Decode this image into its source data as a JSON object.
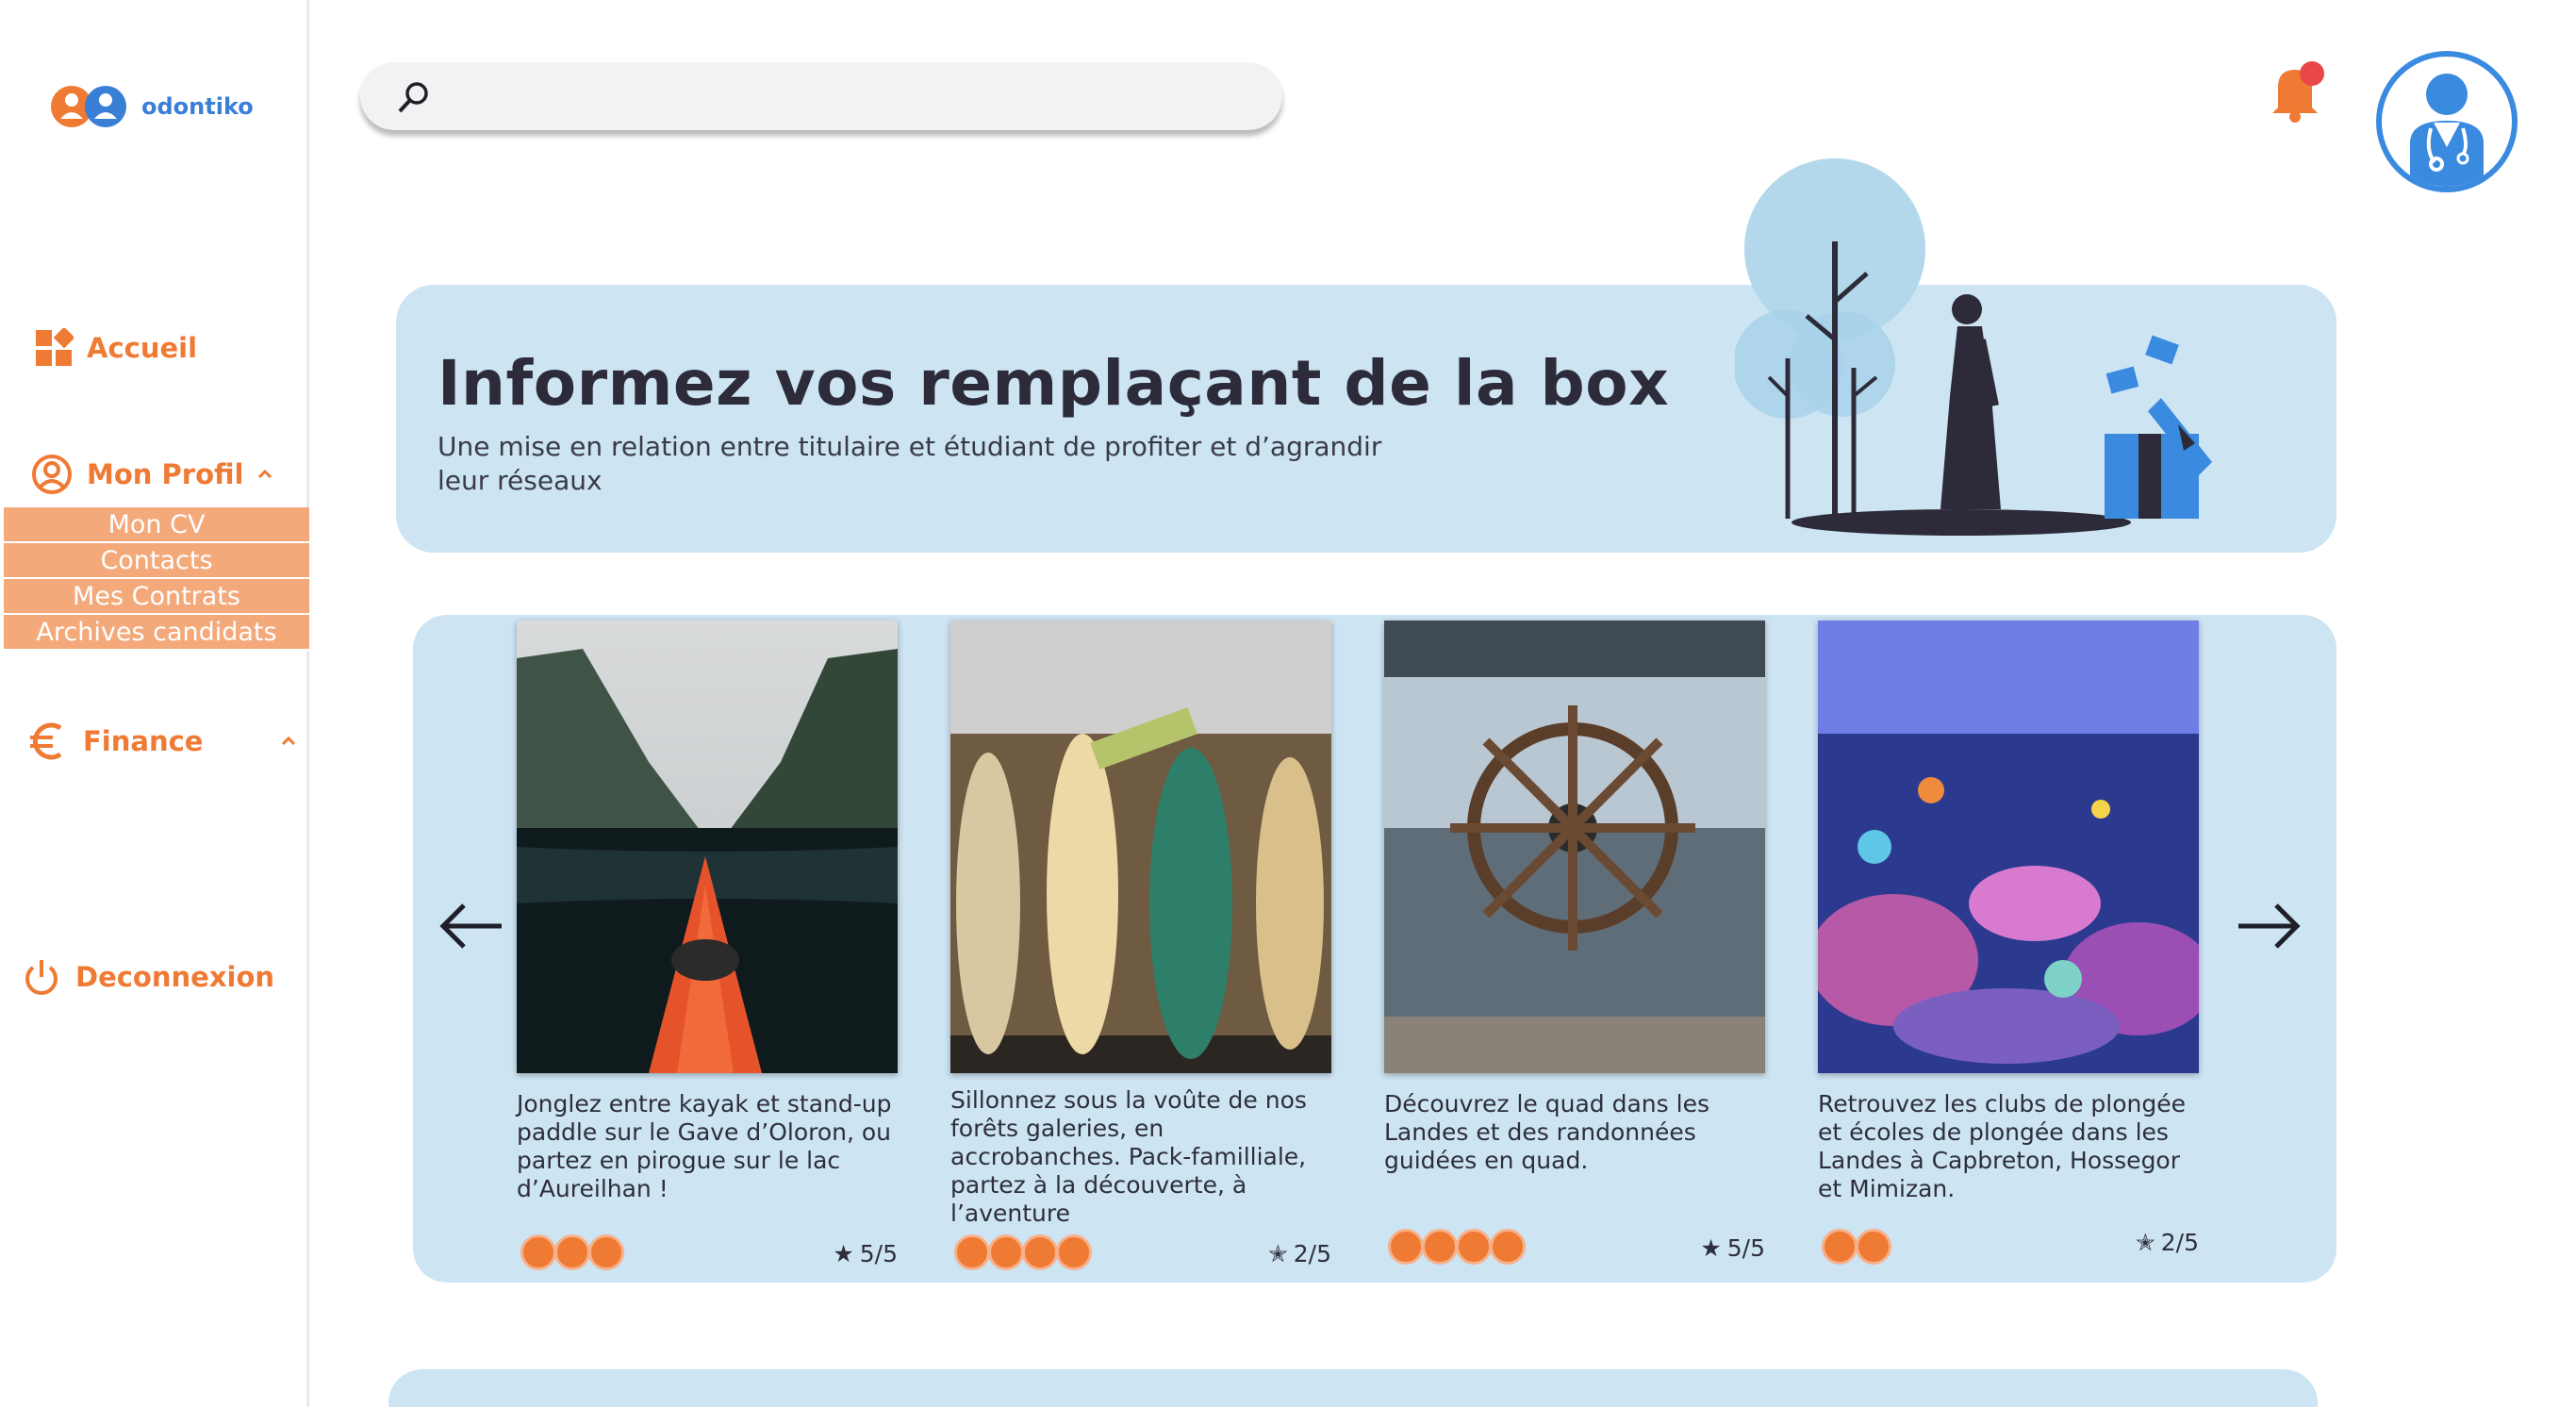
{
  "app": {
    "name": "odontiko"
  },
  "sidebar": {
    "items": [
      {
        "label": "Accueil",
        "icon": "dashboard-icon"
      },
      {
        "label": "Mon Profil",
        "icon": "user-circle-icon"
      },
      {
        "label": "Finance",
        "icon": "euro-icon"
      },
      {
        "label": "Deconnexion",
        "icon": "power-icon"
      }
    ],
    "profile_submenu": [
      "Mon CV",
      "Contacts",
      "Mes Contrats",
      "Archives candidats"
    ]
  },
  "header": {
    "search": {
      "placeholder": "",
      "value": ""
    },
    "notification": {
      "has_unread": true
    }
  },
  "banner": {
    "title": "Informez vos remplaçant de la box",
    "subtitle": "Une mise en relation entre titulaire et étudiant de profiter et d’agrandir leur réseaux"
  },
  "carousel": {
    "cards": [
      {
        "image": "kayak-fjord",
        "description": "Jonglez entre kayak et stand-up paddle sur le Gave d’Oloron, ou partez en pirogue sur le lac d’Aureilhan !",
        "participants": 3,
        "rating": "5/5",
        "star": "filled"
      },
      {
        "image": "surfboards",
        "description": "Sillonnez sous la voûte de nos forêts galeries, en accrobanches. Pack-familliale,  partez à la découverte, à l’aventure",
        "participants": 4,
        "rating": "2/5",
        "star": "half"
      },
      {
        "image": "ship-wheel",
        "description": "Découvrez le quad dans les Landes et des randonnées guidées en quad.",
        "participants": 4,
        "rating": "5/5",
        "star": "filled"
      },
      {
        "image": "coral-reef",
        "description": "Retrouvez les clubs de plongée et écoles de plongée dans les Landes à Capbreton, Hossegor et Mimizan.",
        "participants": 2,
        "rating": "2/5",
        "star": "half"
      }
    ]
  },
  "colors": {
    "accent": "#ef7a33",
    "brand_blue": "#3a8ae0",
    "panel": "#cde4f2"
  }
}
